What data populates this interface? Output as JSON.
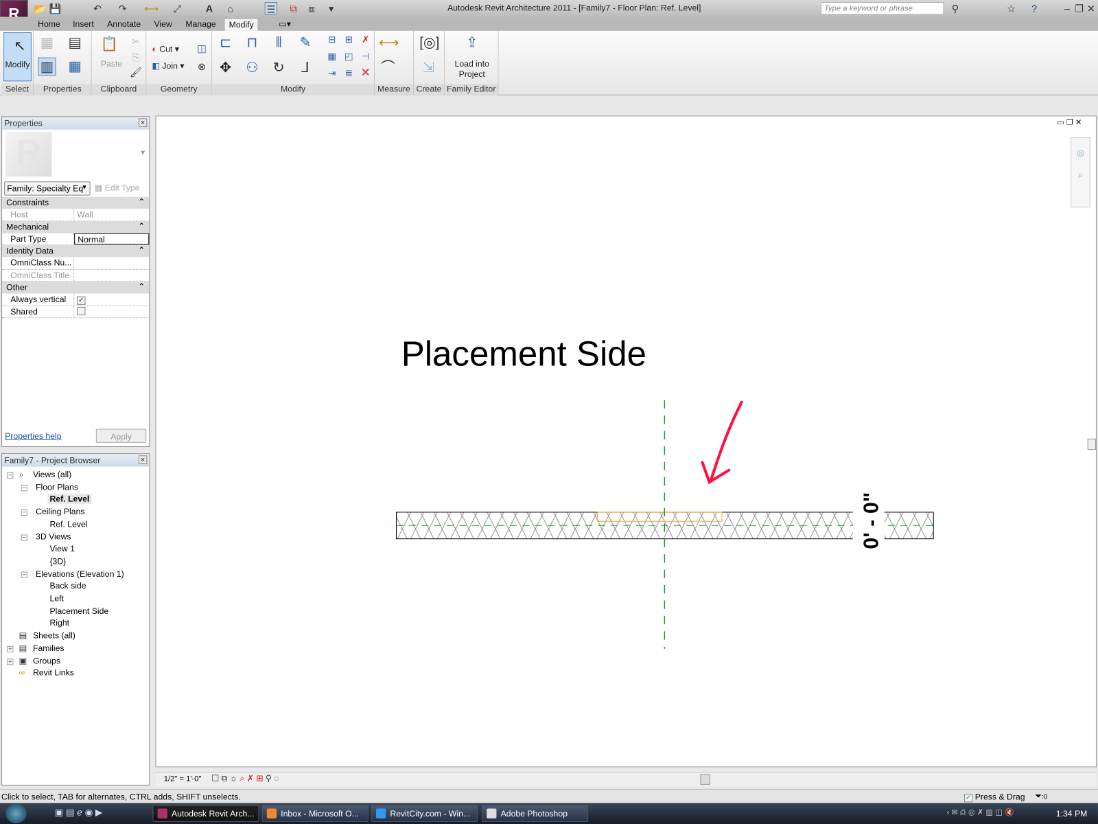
{
  "app": {
    "title": "Autodesk Revit Architecture 2011 - [Family7 - Floor Plan: Ref. Level]",
    "logo": "R",
    "search_placeholder": "Type a keyword or phrase"
  },
  "tabs": [
    "Home",
    "Insert",
    "Annotate",
    "View",
    "Manage",
    "Modify"
  ],
  "ribbon": {
    "panels": [
      "Select",
      "Properties",
      "Clipboard",
      "Geometry",
      "Modify",
      "Measure",
      "Create",
      "Family Editor"
    ],
    "modify_btn": "Modify",
    "paste": "Paste",
    "cut": "Cut",
    "join": "Join",
    "load_into_project": "Load into Project"
  },
  "properties": {
    "title": "Properties",
    "type_selector": "Family: Specialty Eq",
    "edit_type": "Edit Type",
    "groups": [
      {
        "name": "Constraints",
        "rows": [
          {
            "k": "Host",
            "v": "Wall",
            "dim": true
          }
        ]
      },
      {
        "name": "Mechanical",
        "rows": [
          {
            "k": "Part Type",
            "v": "Normal"
          }
        ]
      },
      {
        "name": "Identity Data",
        "rows": [
          {
            "k": "OmniClass Nu...",
            "v": ""
          },
          {
            "k": "OmniClass Title",
            "v": "",
            "dim": true
          }
        ]
      },
      {
        "name": "Other",
        "rows": [
          {
            "k": "Always vertical",
            "checked": true
          },
          {
            "k": "Shared",
            "checked": false
          }
        ]
      }
    ],
    "help": "Properties help",
    "apply": "Apply"
  },
  "browser": {
    "title": "Family7 - Project Browser",
    "nodes": [
      "Views (all)",
      "Floor Plans",
      "Ref. Level",
      "Ceiling Plans",
      "Ref. Level",
      "3D Views",
      "View 1",
      "{3D}",
      "Elevations (Elevation 1)",
      "Back side",
      "Left",
      "Placement Side",
      "Right",
      "Sheets (all)",
      "Families",
      "Groups",
      "Revit Links"
    ]
  },
  "canvas": {
    "view_title": "Placement Side",
    "dimension": "0' - 0\"",
    "colors": {
      "ref_plane": "#1a9a2a",
      "arrow": "#ff1040",
      "opening": "#f0a030"
    }
  },
  "viewbar": {
    "scale": "1/2\" = 1'-0\""
  },
  "status": {
    "message": "Click to select, TAB for alternates, CTRL adds, SHIFT unselects.",
    "press_drag": "Press & Drag",
    "filter_count": ":0"
  },
  "taskbar": {
    "items": [
      "Autodesk Revit Arch...",
      "Inbox - Microsoft O...",
      "RevitCity.com - Win...",
      "Adobe Photoshop"
    ],
    "clock": "1:34 PM"
  }
}
